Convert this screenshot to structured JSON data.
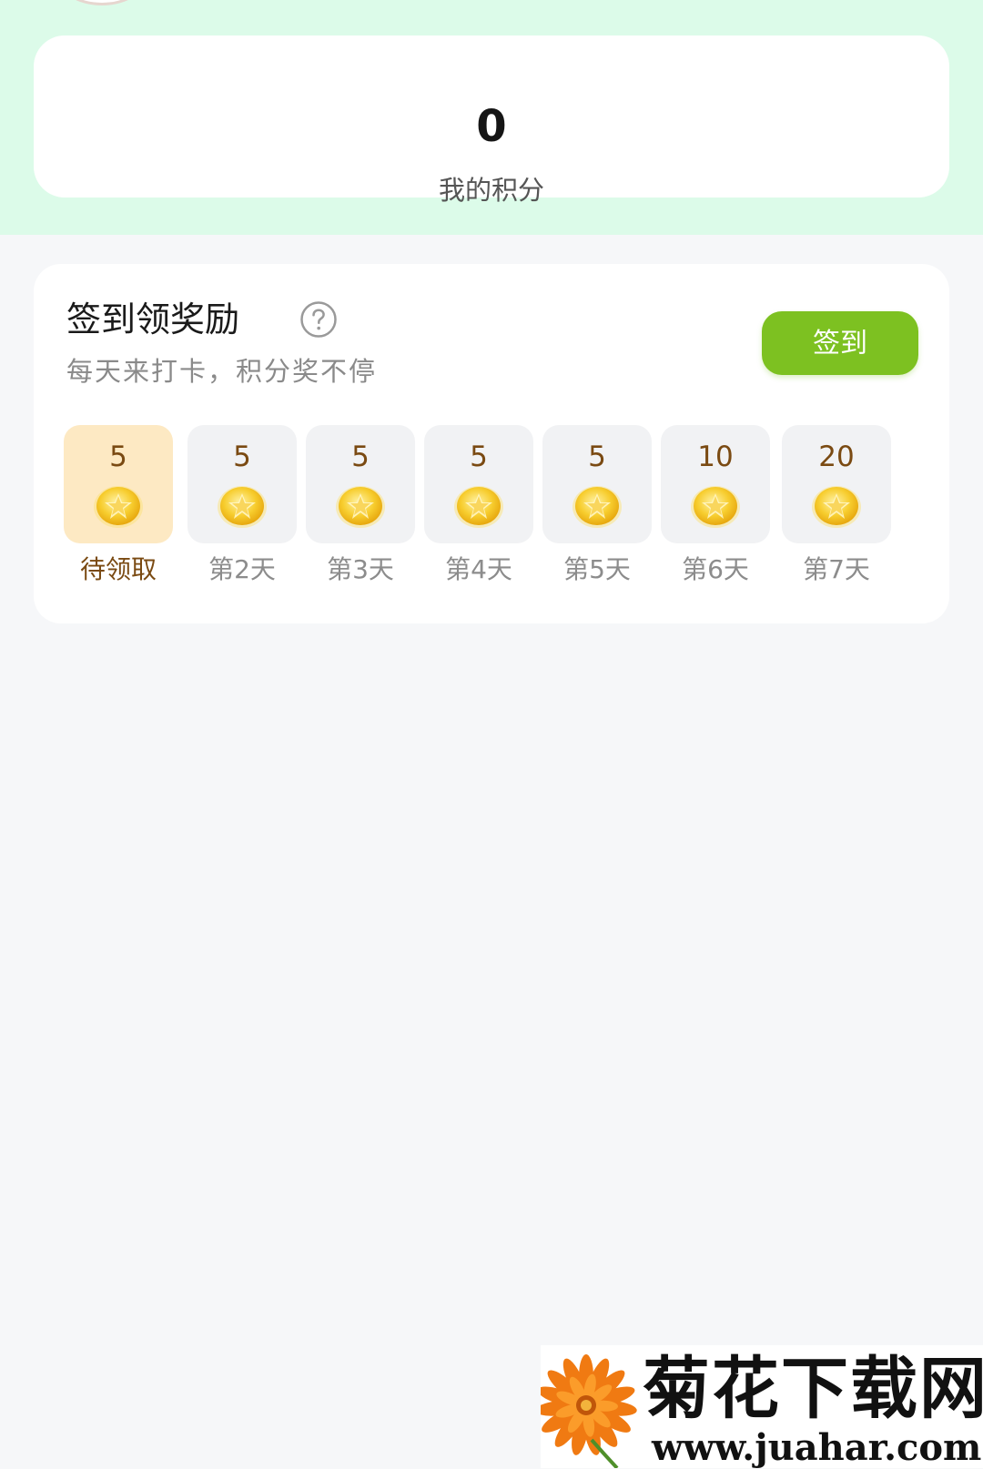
{
  "points": {
    "value": "0",
    "label": "我的积分"
  },
  "checkin": {
    "title": "签到领奖励",
    "subtitle": "每天来打卡，积分奖不停",
    "button_label": "签到",
    "help_icon": "question-circle-icon",
    "days": [
      {
        "amount": "5",
        "label": "待领取",
        "active": true
      },
      {
        "amount": "5",
        "label": "第2天",
        "active": false
      },
      {
        "amount": "5",
        "label": "第3天",
        "active": false
      },
      {
        "amount": "5",
        "label": "第4天",
        "active": false
      },
      {
        "amount": "5",
        "label": "第5天",
        "active": false
      },
      {
        "amount": "10",
        "label": "第6天",
        "active": false
      },
      {
        "amount": "20",
        "label": "第7天",
        "active": false
      }
    ]
  },
  "watermark": {
    "title": "菊花下载网",
    "url": "www.juahar.com"
  },
  "colors": {
    "top_band": "#dcfbe9",
    "button": "#7dc121",
    "active_day": "#fde9c3",
    "amount_text": "#7a4a12",
    "coin": "#f7cd2e"
  }
}
